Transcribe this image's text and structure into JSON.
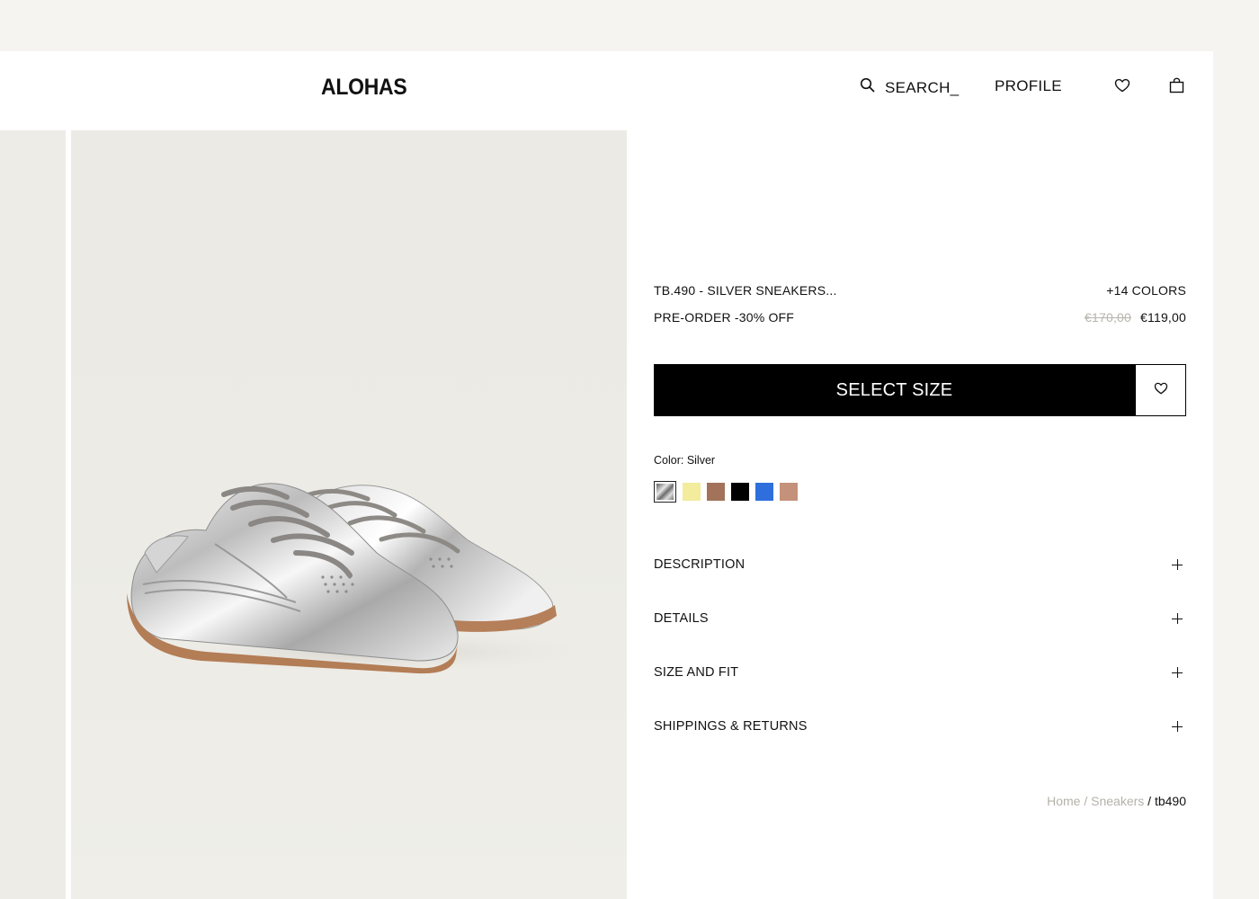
{
  "header": {
    "logo": "ALOHAS",
    "search_label": "SEARCH_",
    "profile_label": "PROFILE"
  },
  "product": {
    "name": "TB.490 - SILVER SNEAKERS...",
    "more_colors": "+14 COLORS",
    "promo": "PRE-ORDER -30% OFF",
    "price_old": "€170,00",
    "price_new": "€119,00",
    "select_size_label": "SELECT SIZE",
    "color_label": "Color: Silver",
    "swatches": [
      {
        "name": "silver",
        "color": "#9a9a9a",
        "selected": true
      },
      {
        "name": "yellow",
        "color": "#f2ec9c"
      },
      {
        "name": "brown",
        "color": "#a2735a"
      },
      {
        "name": "black",
        "color": "#000000"
      },
      {
        "name": "blue",
        "color": "#2f6fdd"
      },
      {
        "name": "tan",
        "color": "#c4917a"
      }
    ]
  },
  "accordion": [
    {
      "label": "DESCRIPTION"
    },
    {
      "label": "DETAILS"
    },
    {
      "label": "SIZE AND FIT"
    },
    {
      "label": "SHIPPINGS & RETURNS"
    }
  ],
  "breadcrumb": {
    "home": "Home",
    "sep1": " / ",
    "category": "Sneakers",
    "sep2": " / ",
    "current": "tb490"
  },
  "icons": {
    "search": "search-icon",
    "wishlist": "heart-icon",
    "bag": "shopping-bag-icon",
    "expand": "plus-icon"
  }
}
